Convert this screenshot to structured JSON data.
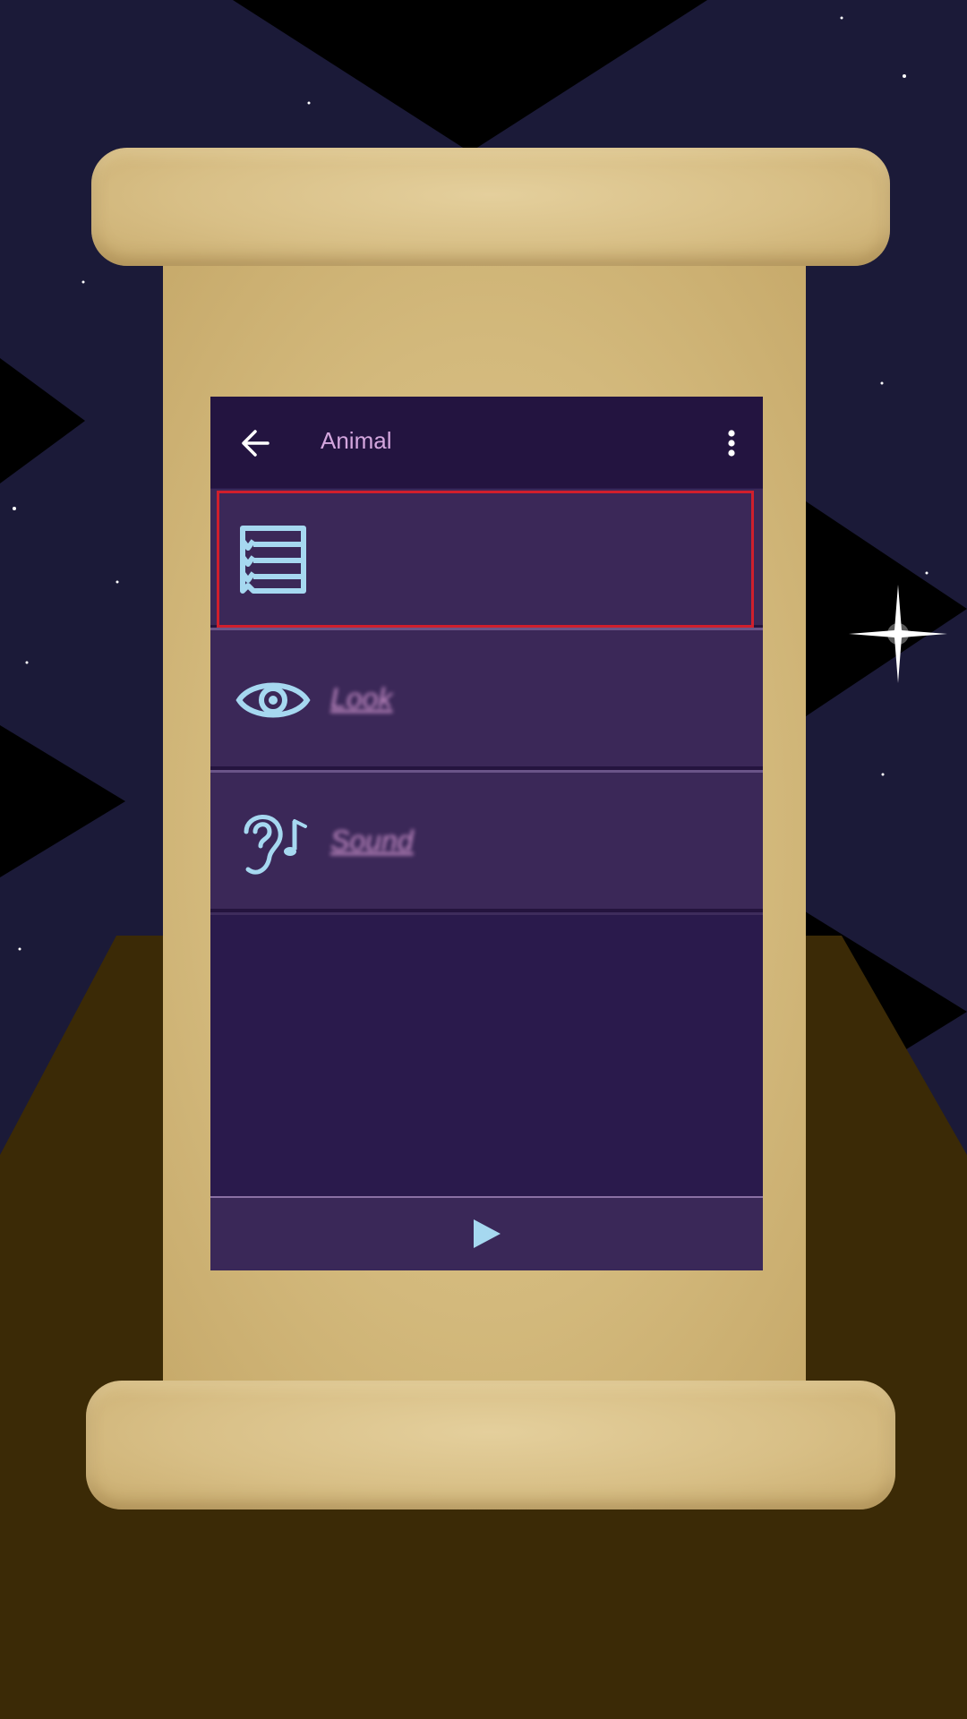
{
  "toolbar": {
    "back_icon": "arrow-left-icon",
    "title": "Animal",
    "menu_icon": "more-vertical-icon"
  },
  "rows": [
    {
      "icon": "list-checklist-icon",
      "label": "",
      "selected": true
    },
    {
      "icon": "eye-icon",
      "label": "Look"
    },
    {
      "icon": "ear-music-icon",
      "label": "Sound"
    }
  ],
  "bottom_bar": {
    "play_icon": "play-icon"
  },
  "colors": {
    "sky": "#1b1a38",
    "floor": "#3b2a06",
    "scroll": "#d8bf86",
    "panel": "#2a1a4c",
    "row": "#3b2858",
    "icon_accent": "#a6d8f0",
    "title_text": "#d4a6de",
    "selection": "#d01f2c"
  }
}
